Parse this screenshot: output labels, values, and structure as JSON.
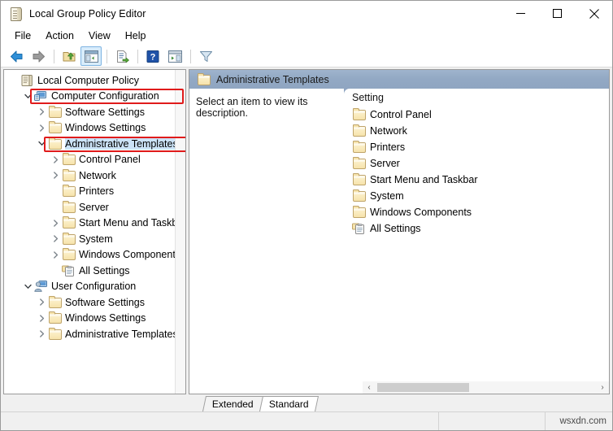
{
  "window": {
    "title": "Local Group Policy Editor",
    "icon": "policy-document-icon",
    "controls": {
      "minimize": "minimize-icon",
      "maximize": "maximize-icon",
      "close": "close-icon"
    }
  },
  "menubar": {
    "items": [
      {
        "label": "File"
      },
      {
        "label": "Action"
      },
      {
        "label": "View"
      },
      {
        "label": "Help"
      }
    ]
  },
  "toolbar": {
    "buttons": [
      {
        "name": "back-icon",
        "title": "Back"
      },
      {
        "name": "forward-icon",
        "title": "Forward"
      },
      {
        "name": "up-one-level-icon",
        "title": "Up One Level"
      },
      {
        "name": "show-hide-console-tree-icon",
        "title": "Show/Hide Console Tree",
        "active": true
      },
      {
        "name": "export-list-icon",
        "title": "Export List"
      },
      {
        "name": "help-icon",
        "title": "Help"
      },
      {
        "name": "show-action-pane-icon",
        "title": "Show/Hide Action Pane"
      },
      {
        "name": "filter-icon",
        "title": "Filter"
      }
    ]
  },
  "tree": {
    "root": {
      "label": "Local Computer Policy",
      "icon": "policy-scroll-icon"
    },
    "nodes": [
      {
        "label": "Local Computer Policy",
        "icon": "policy-scroll-icon",
        "indent": 0,
        "twisty": "",
        "selected": false,
        "highlight": false
      },
      {
        "label": "Computer Configuration",
        "icon": "computer-icon",
        "indent": 1,
        "twisty": "expanded",
        "selected": false,
        "highlight": true
      },
      {
        "label": "Software Settings",
        "icon": "folder-icon",
        "indent": 2,
        "twisty": "collapsed",
        "selected": false,
        "highlight": false
      },
      {
        "label": "Windows Settings",
        "icon": "folder-icon",
        "indent": 2,
        "twisty": "collapsed",
        "selected": false,
        "highlight": false
      },
      {
        "label": "Administrative Templates",
        "icon": "folder-icon",
        "indent": 2,
        "twisty": "expanded",
        "selected": true,
        "highlight": true
      },
      {
        "label": "Control Panel",
        "icon": "folder-icon",
        "indent": 3,
        "twisty": "collapsed",
        "selected": false,
        "highlight": false
      },
      {
        "label": "Network",
        "icon": "folder-icon",
        "indent": 3,
        "twisty": "collapsed",
        "selected": false,
        "highlight": false
      },
      {
        "label": "Printers",
        "icon": "folder-icon",
        "indent": 3,
        "twisty": "",
        "selected": false,
        "highlight": false
      },
      {
        "label": "Server",
        "icon": "folder-icon",
        "indent": 3,
        "twisty": "",
        "selected": false,
        "highlight": false
      },
      {
        "label": "Start Menu and Taskbar",
        "icon": "folder-icon",
        "indent": 3,
        "twisty": "collapsed",
        "selected": false,
        "highlight": false
      },
      {
        "label": "System",
        "icon": "folder-icon",
        "indent": 3,
        "twisty": "collapsed",
        "selected": false,
        "highlight": false
      },
      {
        "label": "Windows Components",
        "icon": "folder-icon",
        "indent": 3,
        "twisty": "collapsed",
        "selected": false,
        "highlight": false
      },
      {
        "label": "All Settings",
        "icon": "all-settings-icon",
        "indent": 3,
        "twisty": "",
        "selected": false,
        "highlight": false
      },
      {
        "label": "User Configuration",
        "icon": "user-icon",
        "indent": 1,
        "twisty": "expanded",
        "selected": false,
        "highlight": false
      },
      {
        "label": "Software Settings",
        "icon": "folder-icon",
        "indent": 2,
        "twisty": "collapsed",
        "selected": false,
        "highlight": false
      },
      {
        "label": "Windows Settings",
        "icon": "folder-icon",
        "indent": 2,
        "twisty": "collapsed",
        "selected": false,
        "highlight": false
      },
      {
        "label": "Administrative Templates",
        "icon": "folder-icon",
        "indent": 2,
        "twisty": "collapsed",
        "selected": false,
        "highlight": false
      }
    ]
  },
  "details": {
    "header": {
      "title": "Administrative Templates",
      "icon": "folder-icon"
    },
    "description": "Select an item to view its description.",
    "column_header": "Setting",
    "items": [
      {
        "label": "Control Panel",
        "icon": "folder-icon"
      },
      {
        "label": "Network",
        "icon": "folder-icon"
      },
      {
        "label": "Printers",
        "icon": "folder-icon"
      },
      {
        "label": "Server",
        "icon": "folder-icon"
      },
      {
        "label": "Start Menu and Taskbar",
        "icon": "folder-icon"
      },
      {
        "label": "System",
        "icon": "folder-icon"
      },
      {
        "label": "Windows Components",
        "icon": "folder-icon"
      },
      {
        "label": "All Settings",
        "icon": "all-settings-icon"
      }
    ],
    "scroll": {
      "left_arrow": "‹",
      "right_arrow": "›"
    }
  },
  "tabs": [
    {
      "label": "Extended",
      "active": false
    },
    {
      "label": "Standard",
      "active": true
    }
  ],
  "statusbar": {
    "watermark": "wsxdn.com"
  },
  "colors": {
    "highlight_box": "#e01b1b",
    "selection": "#cce3f7",
    "header_blue": "#93a9c4",
    "folder_yellow": "#f6e3ab"
  }
}
